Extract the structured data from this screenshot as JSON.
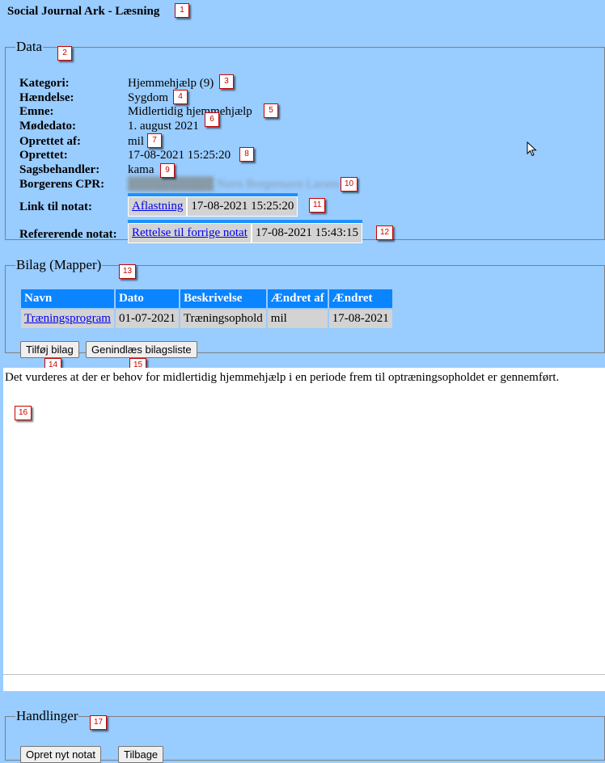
{
  "page": {
    "title": "Social Journal Ark - Læsning"
  },
  "data_section": {
    "legend": "Data",
    "fields": [
      {
        "label": "Kategori:",
        "value": "Hjemmehjælp (9)"
      },
      {
        "label": "Hændelse:",
        "value": "Sygdom"
      },
      {
        "label": "Emne:",
        "value": "Midlertidig hjemmehjælp"
      },
      {
        "label": "Mødedato:",
        "value": "1. august 2021"
      },
      {
        "label": "Oprettet af:",
        "value": "mil"
      },
      {
        "label": "Oprettet:",
        "value": "17-08-2021 15:25:20"
      },
      {
        "label": "Sagsbehandler:",
        "value": "kama"
      },
      {
        "label": "Borgerens CPR:",
        "value": "██████████ Navn Borgernavn Larsen"
      }
    ],
    "link_label": "Link til notat:",
    "link_text": "Aflastning",
    "link_date": "17-08-2021 15:25:20",
    "ref_label": "Refererende notat:",
    "ref_text": "Rettelse til forrige notat",
    "ref_date": "17-08-2021 15:43:15"
  },
  "bilag_section": {
    "legend": "Bilag (Mapper)",
    "columns": [
      "Navn",
      "Dato",
      "Beskrivelse",
      "Ændret af",
      "Ændret"
    ],
    "rows": [
      [
        "Træningsprogram",
        "01-07-2021",
        "Træningsophold",
        "mil",
        "17-08-2021"
      ]
    ],
    "add_button": "Tilføj bilag",
    "reload_button": "Genindlæs bilagsliste"
  },
  "note": {
    "text": "Det vurderes at  der er behov for midlertidig hjemmehjælp i en periode frem til optræningsopholdet er gennemført."
  },
  "actions_section": {
    "legend": "Handlinger",
    "new_button": "Opret nyt notat",
    "back_button": "Tilbage"
  },
  "badges": [
    "1",
    "2",
    "3",
    "4",
    "5",
    "6",
    "7",
    "8",
    "9",
    "10",
    "11",
    "12",
    "13",
    "14",
    "15",
    "16",
    "17"
  ]
}
